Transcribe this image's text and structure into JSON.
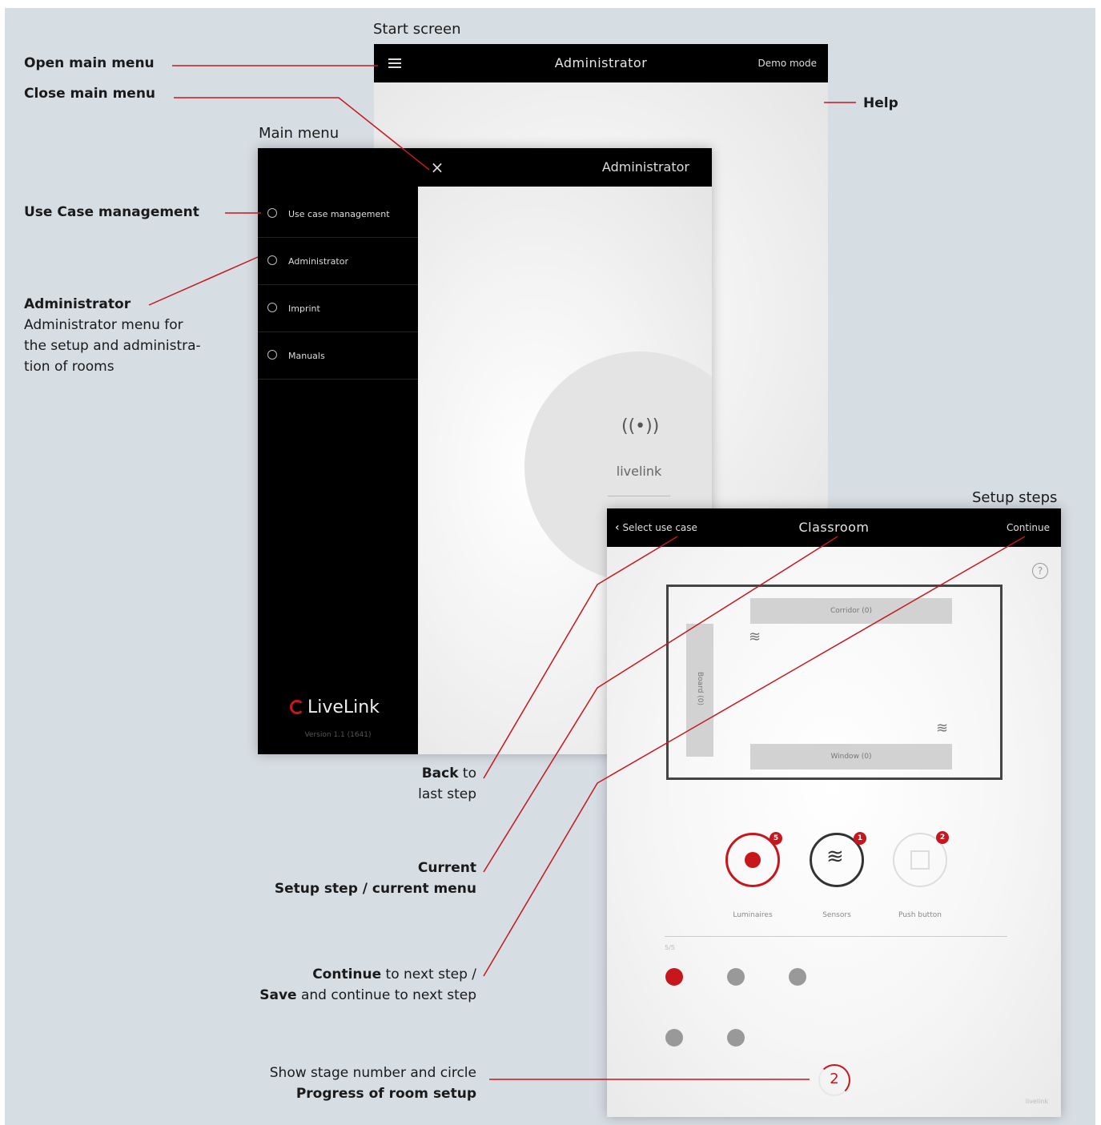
{
  "captions": {
    "start_screen": "Start screen",
    "main_menu": "Main menu",
    "setup_steps": "Setup steps"
  },
  "annotations": {
    "open_main_menu": "Open main menu",
    "close_main_menu": "Close main menu",
    "help": "Help",
    "use_case_management": "Use Case management",
    "administrator_title": "Administrator",
    "administrator_desc_1": "Administrator menu for",
    "administrator_desc_2": "the setup and administra-",
    "administrator_desc_3": "tion of rooms",
    "back_bold": "Back",
    "back_rest": " to",
    "back_line2": "last step",
    "current_bold": "Current",
    "current_line2": "Setup step / current menu",
    "continue_bold": "Continue",
    "continue_rest": " to next step /",
    "save_bold": "Save",
    "save_rest": " and continue to next step",
    "progress_line1": "Show stage number and circle",
    "progress_line2": "Progress of room setup"
  },
  "start_screen": {
    "title": "Administrator",
    "demo_mode": "Demo mode"
  },
  "main_menu": {
    "title": "Administrator",
    "items": [
      {
        "label": "Use case management",
        "icon": "use-case-icon"
      },
      {
        "label": "Administrator",
        "icon": "administrator-icon"
      },
      {
        "label": "Imprint",
        "icon": "imprint-icon"
      },
      {
        "label": "Manuals",
        "icon": "manuals-icon"
      }
    ],
    "brand": "LiveLink",
    "version": "Version 1.1 (1641)",
    "center_label": "livelink"
  },
  "setup": {
    "back": "Select use case",
    "title": "Classroom",
    "continue": "Continue",
    "room": {
      "corridor": "Corridor (0)",
      "board": "Board (0)",
      "window": "Window (0)"
    },
    "categories": [
      {
        "label": "Luminaires",
        "count": "5"
      },
      {
        "label": "Sensors",
        "count": "1"
      },
      {
        "label": "Push button",
        "count": "2"
      }
    ],
    "list_header": "5/5",
    "stage_number": "2",
    "footer": "livelink"
  },
  "colors": {
    "accent_red": "#c8161d",
    "background": "#d6dde3",
    "bar_black": "#000000"
  }
}
